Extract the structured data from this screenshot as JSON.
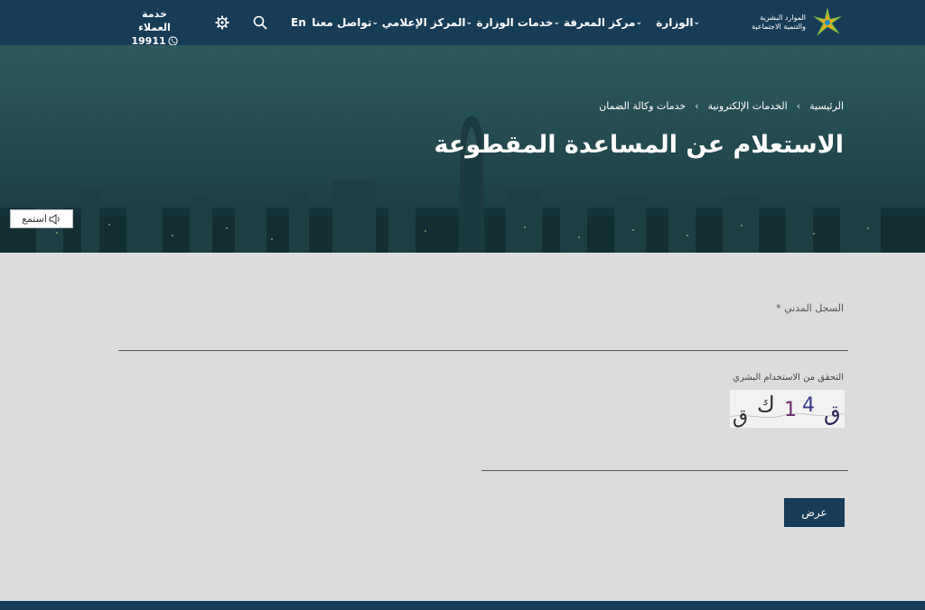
{
  "header": {
    "logo_line1": "الموارد البشرية",
    "logo_line2": "والتنمية الاجتماعية",
    "nav": [
      {
        "label": "الوزارة"
      },
      {
        "label": "مركز المعرفة"
      },
      {
        "label": "خدمات الوزارة"
      },
      {
        "label": "المركز الإعلامي"
      },
      {
        "label": "تواصل معنا"
      }
    ],
    "language": "En",
    "customer_service_label": "خدمة العملاء",
    "customer_service_number": "19911"
  },
  "hero": {
    "breadcrumb": [
      "الرئيسية",
      "الخدمات الإلكترونية",
      "خدمات وكالة الضمان"
    ],
    "title": "الاستعلام عن المساعدة المقطوعة",
    "listen_label": "استمع"
  },
  "form": {
    "civil_label": "السجل المدني",
    "required_mark": "*",
    "captcha_label": "التحقق من الاستخدام البشري",
    "captcha_chars": [
      "ق",
      "4",
      "1",
      "ك",
      "ق"
    ],
    "submit_label": "عرض"
  },
  "colors": {
    "navbar": "#163c58",
    "page_bg": "#dcdcdc",
    "button": "#163c58"
  }
}
